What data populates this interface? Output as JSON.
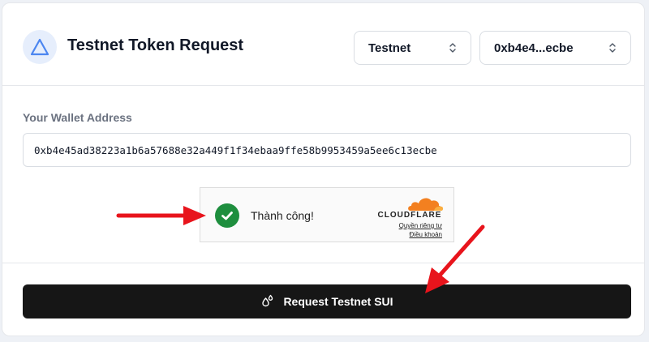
{
  "header": {
    "title": "Testnet Token Request",
    "network_select": "Testnet",
    "wallet_select": "0xb4e4...ecbe"
  },
  "form": {
    "wallet_label": "Your Wallet Address",
    "wallet_value": "0xb4e45ad38223a1b6a57688e32a449f1f34ebaa9ffe58b9953459a5ee6c13ecbe"
  },
  "captcha": {
    "status": "Thành công!",
    "brand": "CLOUDFLARE",
    "privacy_link": "Quyền riêng tư",
    "terms_link": "Điều khoản"
  },
  "actions": {
    "request_label": "Request Testnet SUI"
  },
  "colors": {
    "accent": "#4c86f0",
    "success": "#1e8e3e",
    "cloudflare_orange": "#f38020",
    "annotation_arrow": "#e8141c",
    "button_bg": "#161616"
  },
  "icons": {
    "logo": "sui-triangle-icon",
    "select_chevron": "chevron-up-down-icon",
    "status": "check-circle-icon",
    "button": "water-drops-icon"
  }
}
